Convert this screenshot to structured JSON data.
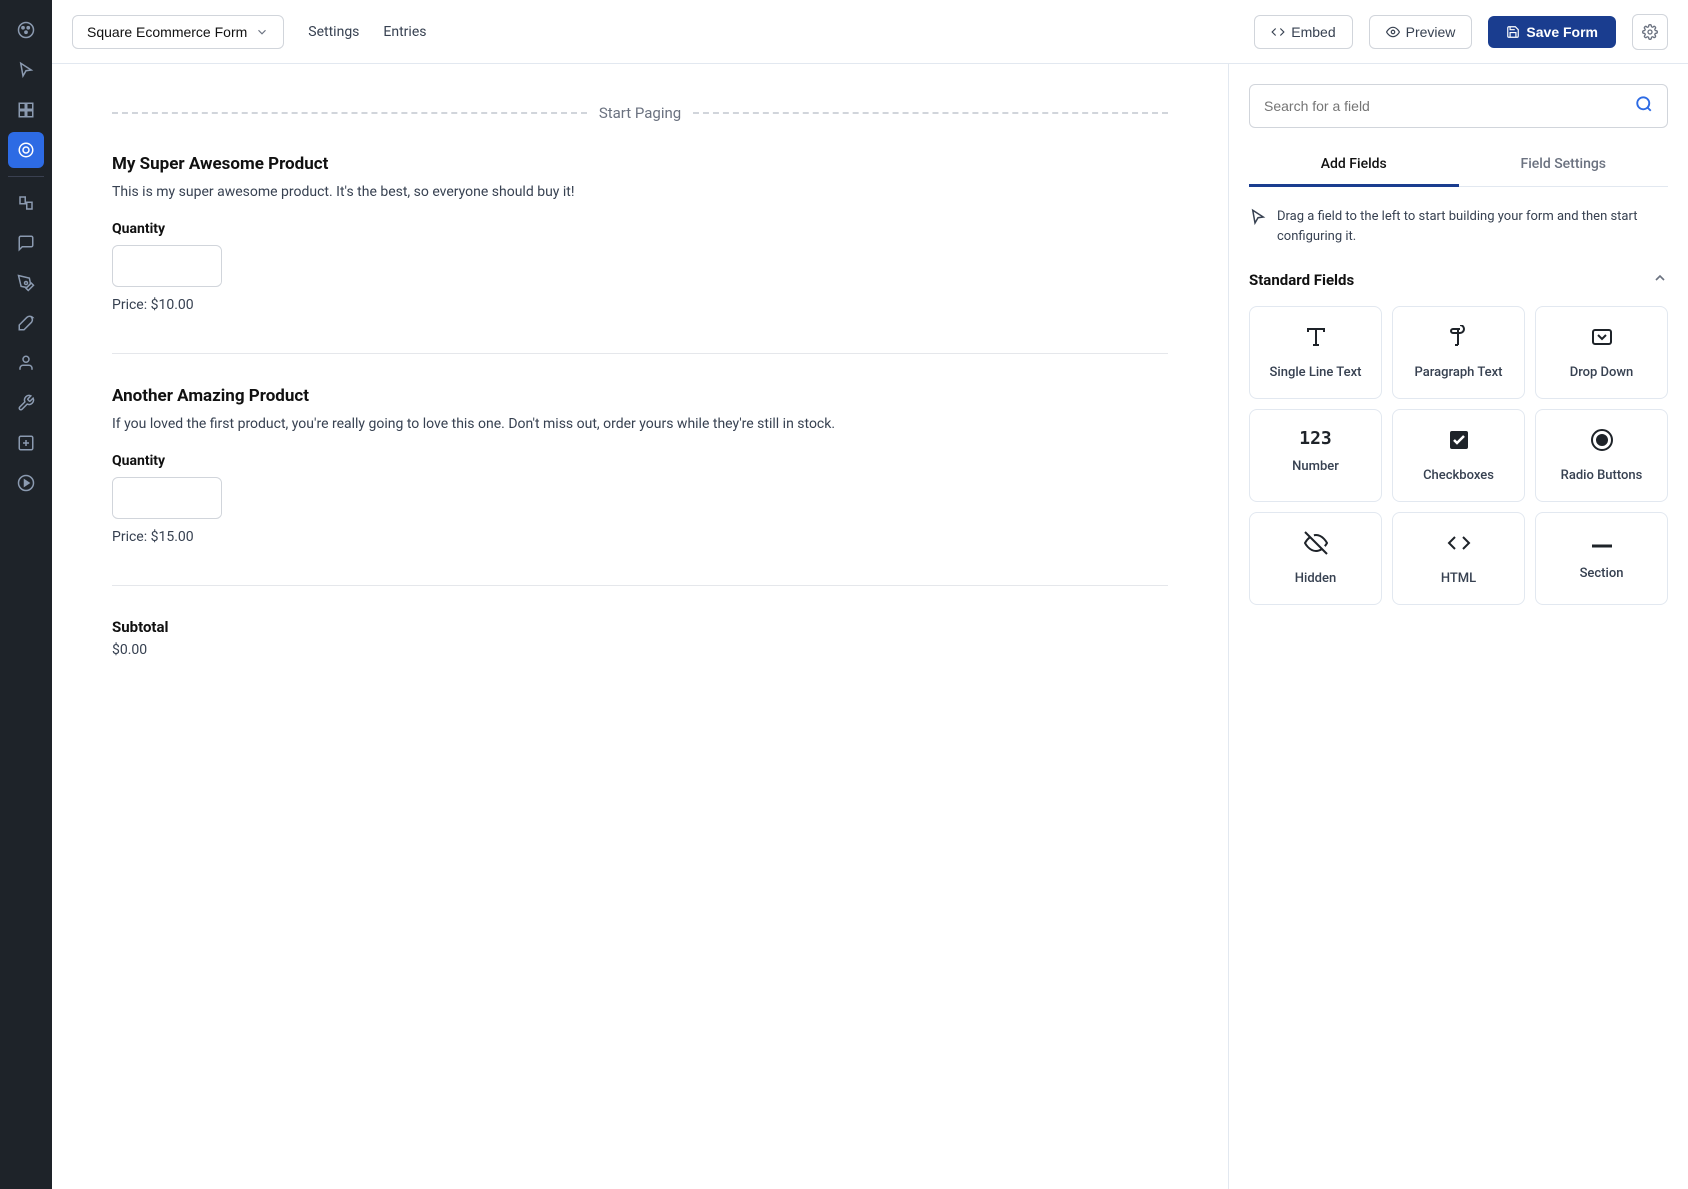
{
  "sidebar": {
    "icons": [
      {
        "name": "palette-icon",
        "symbol": "🎨",
        "active": false
      },
      {
        "name": "cursor-icon",
        "symbol": "↗",
        "active": false
      },
      {
        "name": "blocks-icon",
        "symbol": "⊞",
        "active": false
      },
      {
        "name": "form-icon",
        "symbol": "◉",
        "active": true
      },
      {
        "name": "pages-icon",
        "symbol": "⧉",
        "active": false
      },
      {
        "name": "comments-icon",
        "symbol": "💬",
        "active": false
      },
      {
        "name": "brush-icon",
        "symbol": "✏",
        "active": false
      },
      {
        "name": "paint-icon",
        "symbol": "🖌",
        "active": false
      },
      {
        "name": "person-icon",
        "symbol": "👤",
        "active": false
      },
      {
        "name": "wrench-icon",
        "symbol": "🔧",
        "active": false
      },
      {
        "name": "add-block-icon",
        "symbol": "⊕",
        "active": false
      },
      {
        "name": "play-icon",
        "symbol": "▶",
        "active": false
      }
    ]
  },
  "topbar": {
    "form_name": "Square Ecommerce Form",
    "nav_settings": "Settings",
    "nav_entries": "Entries",
    "embed_label": "Embed",
    "preview_label": "Preview",
    "save_label": "Save Form"
  },
  "form_builder": {
    "start_paging_label": "Start Paging",
    "products": [
      {
        "title": "My Super Awesome Product",
        "description": "This is my super awesome product. It's the best, so everyone should buy it!",
        "quantity_label": "Quantity",
        "price_label": "Price: $10.00"
      },
      {
        "title": "Another Amazing Product",
        "description": "If you loved the first product, you're really going to love this one. Don't miss out, order yours while they're still in stock.",
        "quantity_label": "Quantity",
        "price_label": "Price: $15.00"
      }
    ],
    "subtotal_label": "Subtotal",
    "subtotal_value": "$0.00"
  },
  "right_panel": {
    "search_placeholder": "Search for a field",
    "tab_add_fields": "Add Fields",
    "tab_field_settings": "Field Settings",
    "drag_hint": "Drag a field to the left to start building your form and then start configuring it.",
    "standard_fields_title": "Standard Fields",
    "fields": [
      {
        "name": "single-line-text",
        "icon": "𝐀",
        "label": "Single Line Text"
      },
      {
        "name": "paragraph-text",
        "icon": "¶",
        "label": "Paragraph Text"
      },
      {
        "name": "drop-down",
        "icon": "▾□",
        "label": "Drop Down"
      },
      {
        "name": "number",
        "icon": "123",
        "label": "Number"
      },
      {
        "name": "checkboxes",
        "icon": "☑",
        "label": "Checkboxes"
      },
      {
        "name": "radio-buttons",
        "icon": "◉",
        "label": "Radio Buttons"
      },
      {
        "name": "hidden",
        "icon": "👁‍🗨",
        "label": "Hidden"
      },
      {
        "name": "html",
        "icon": "<>",
        "label": "HTML"
      },
      {
        "name": "section",
        "icon": "—",
        "label": "Section"
      }
    ]
  }
}
